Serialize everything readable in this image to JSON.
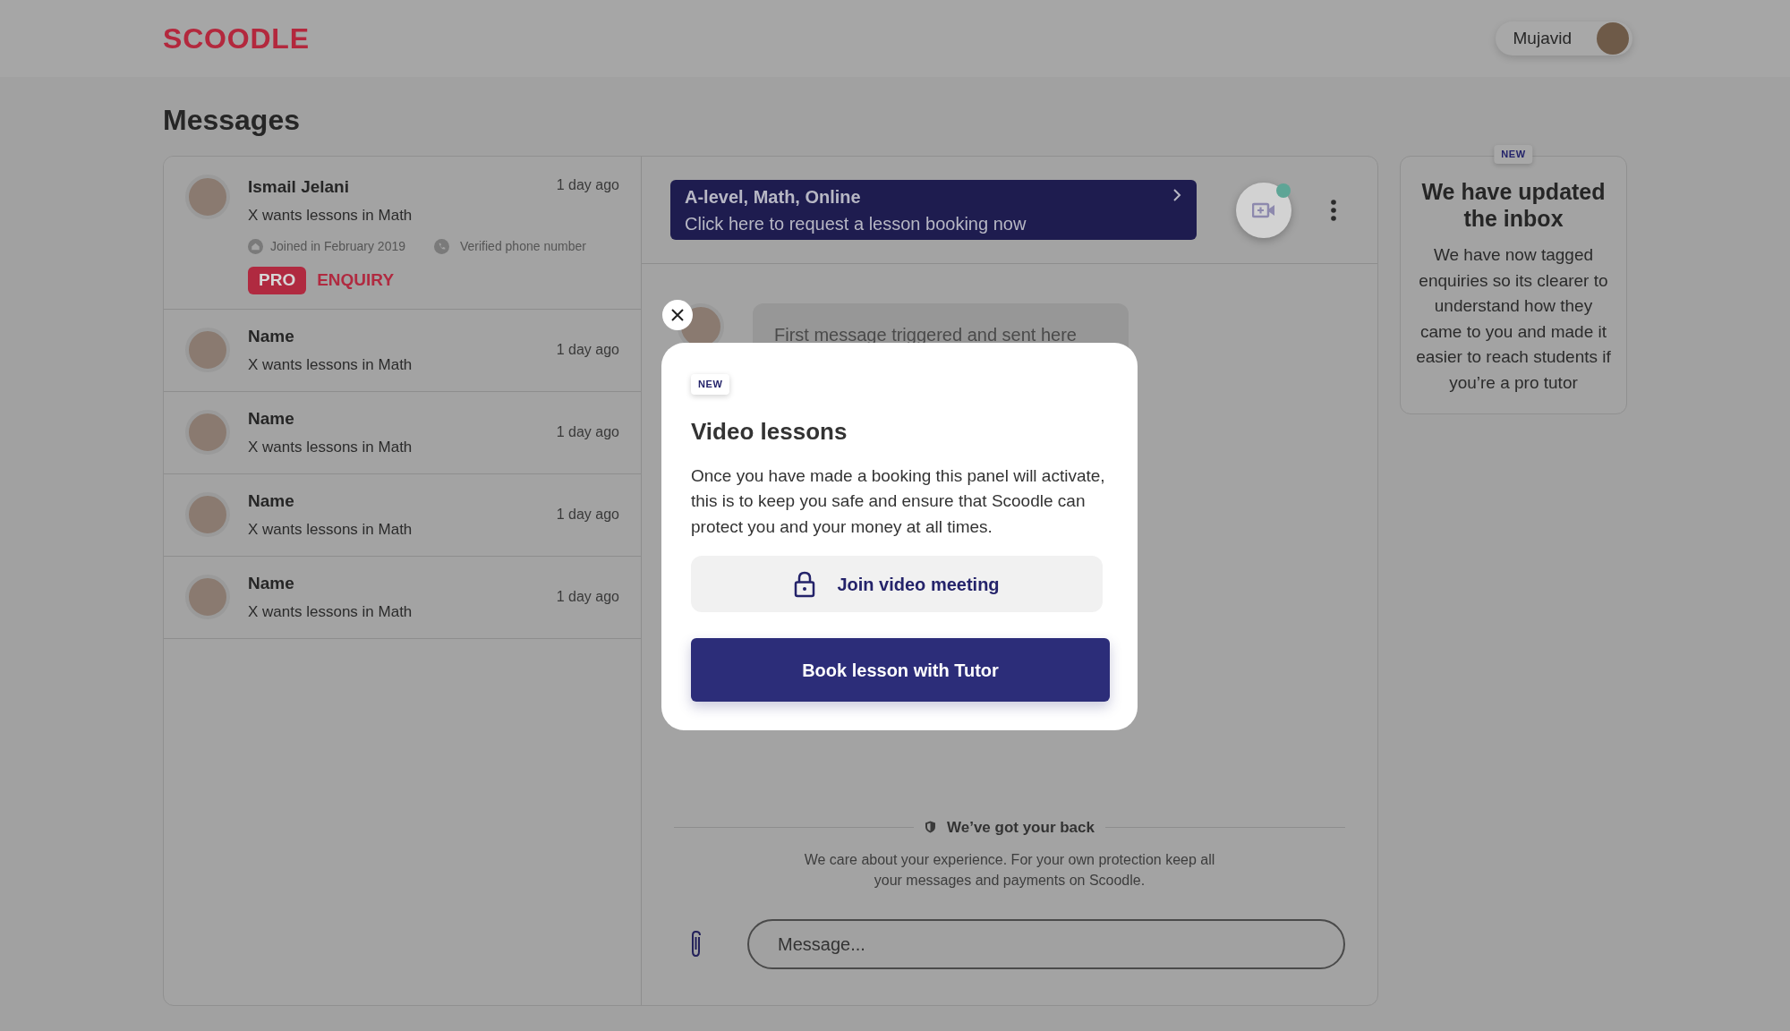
{
  "header": {
    "logo": "SCOODLE",
    "user": {
      "name": "Mujavid"
    }
  },
  "page_title": "Messages",
  "conversations": [
    {
      "name": "Ismail Jelani",
      "subtitle": "X wants lessons in Math",
      "time": "1 day ago",
      "joined": "Joined in February 2019",
      "verified": "Verified phone number",
      "badge": "PRO",
      "tag": "ENQUIRY"
    },
    {
      "name": "Name",
      "subtitle": "X wants lessons in Math",
      "time": "1 day ago"
    },
    {
      "name": "Name",
      "subtitle": "X wants lessons in Math",
      "time": "1 day ago"
    },
    {
      "name": "Name",
      "subtitle": "X wants lessons in Math",
      "time": "1 day ago"
    },
    {
      "name": "Name",
      "subtitle": "X wants lessons in Math",
      "time": "1 day ago"
    }
  ],
  "chat": {
    "banner": {
      "title": "A-level, Math, Online",
      "subtitle": "Click here to request a lesson booking now"
    },
    "video_call": {
      "notification": true
    },
    "first_message": "First message triggered and sent here",
    "safety": {
      "title": "We’ve got your back",
      "text": "We care about your experience. For your own protection keep all your messages and payments on Scoodle."
    },
    "composer": {
      "placeholder": "Message..."
    }
  },
  "modal": {
    "badge": "NEW",
    "title": "Video lessons",
    "text": "Once you have made a booking this panel will activate, this is to keep you safe and ensure that Scoodle can protect you and your money at all times.",
    "locked_button": "Join video meeting",
    "primary_button": "Book lesson with Tutor"
  },
  "announcement": {
    "badge": "NEW",
    "title": "We have updated the inbox",
    "text": "We have now tagged enquiries so its clearer to understand how they came to you and made it easier to reach students if you’re a pro tutor"
  }
}
